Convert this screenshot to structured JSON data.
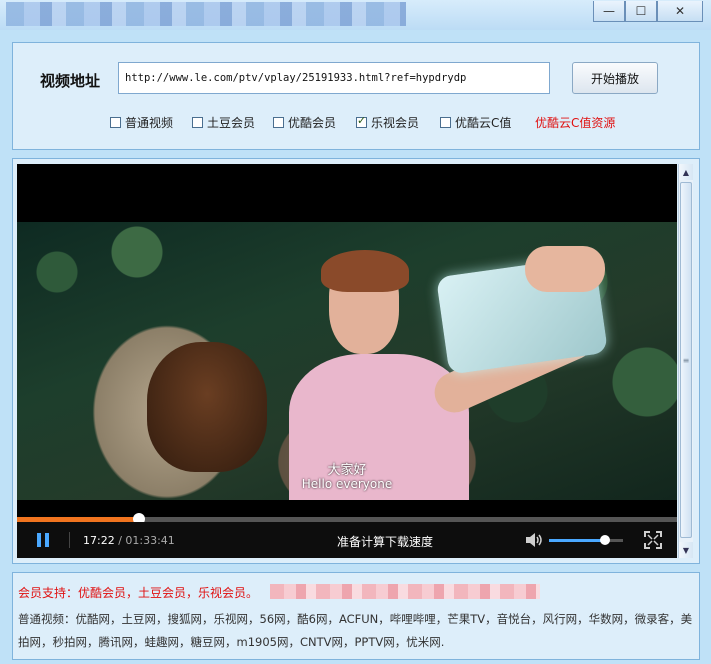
{
  "window": {
    "minimize_glyph": "—",
    "maximize_glyph": "☐",
    "close_glyph": "✕"
  },
  "url_bar": {
    "label": "视频地址",
    "value": "http://www.le.com/ptv/vplay/25191933.html?ref=hypdrydp",
    "play_button": "开始播放"
  },
  "options": [
    {
      "label": "普通视频",
      "checked": false
    },
    {
      "label": "土豆会员",
      "checked": false
    },
    {
      "label": "优酷会员",
      "checked": false
    },
    {
      "label": "乐视会员",
      "checked": true
    },
    {
      "label": "优酷云C值",
      "checked": false
    }
  ],
  "resource_link": "优酷云C值资源",
  "player": {
    "subtitle_cn": "大家好",
    "subtitle_en": "Hello everyone",
    "time_current": "17:22",
    "time_total": "/ 01:33:41",
    "progress": 0.185,
    "status": "准备计算下载速度",
    "volume": 0.75
  },
  "info": {
    "member_support": "会员支持：优酷会员，土豆会员，乐视会员。",
    "normal_sites": "普通视频：优酷网，土豆网，搜狐网，乐视网，56网，酷6网，ACFUN，哔哩哔哩，芒果TV，音悦台，风行网，华数网，微录客，美拍网，秒拍网，腾讯网，蛙趣网，糖豆网，m1905网，CNTV网，PPTV网，忧米网."
  },
  "colors": {
    "accent": "#4aa8ff",
    "progress": "#f0741f",
    "link_red": "#e01010"
  }
}
